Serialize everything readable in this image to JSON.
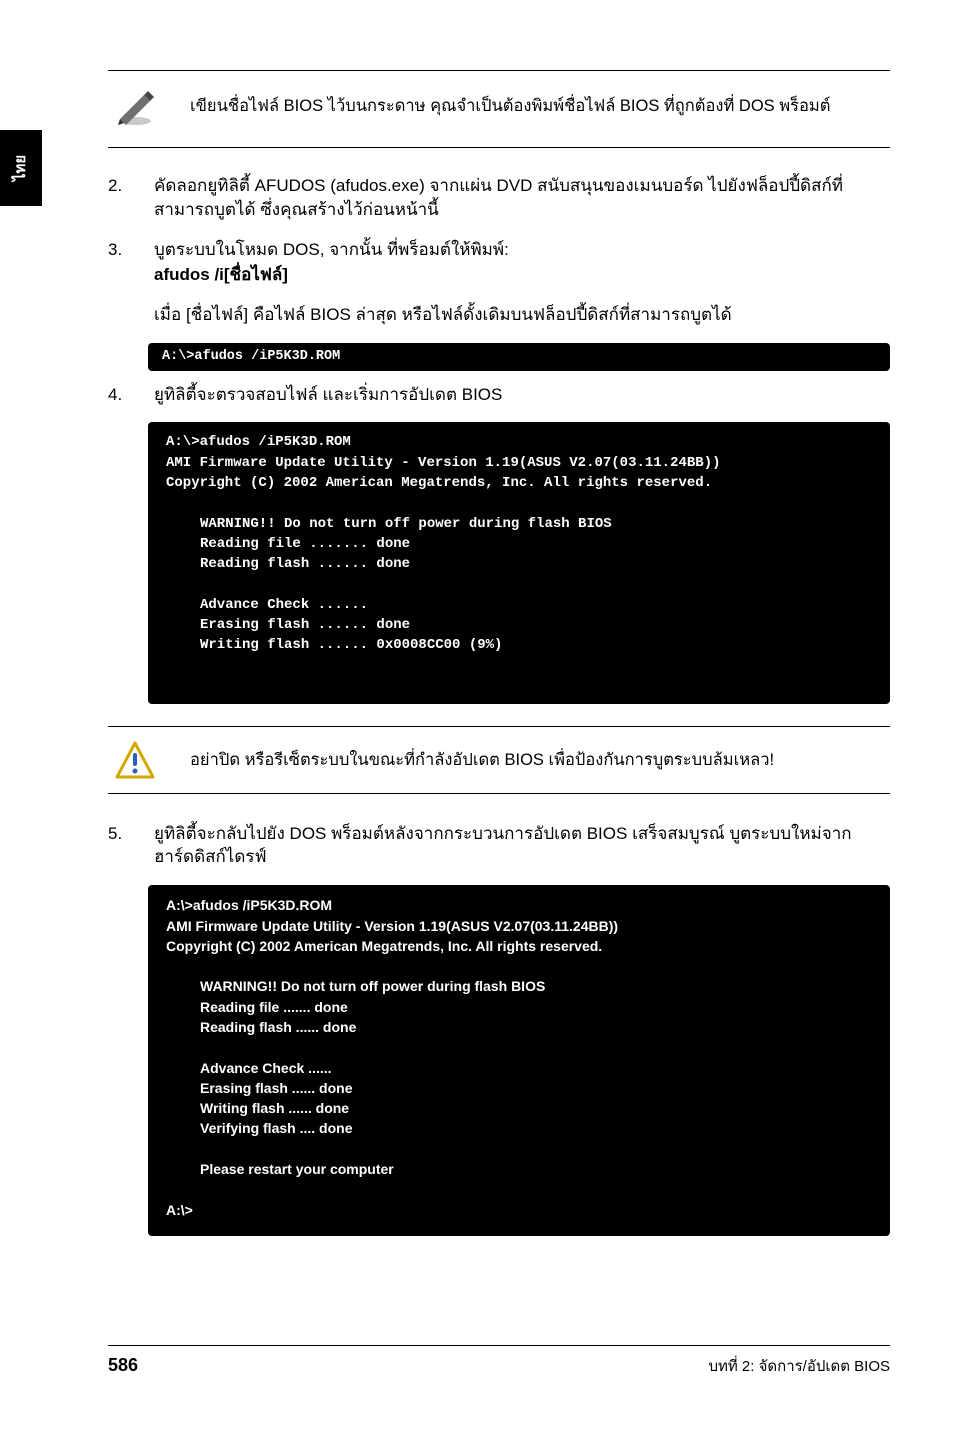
{
  "side_tab": "ไทย",
  "note1": {
    "icon": "pencil-icon",
    "text": "เขียนชื่อไฟล์ BIOS ไว้บนกระดาษ คุณจำเป็นต้องพิมพ์ชื่อไฟล์ BIOS ที่ถูกต้องที่ DOS พร็อมต์"
  },
  "steps": {
    "s2": {
      "num": "2.",
      "text": "คัดลอกยูทิลิตี้ AFUDOS (afudos.exe) จากแผ่น DVD สนับสนุนของเมนบอร์ด ไปยังฟล็อปปี้ดิสก์ที่สามารถบูตได้ ซึ่งคุณสร้างไว้ก่อนหน้านี้"
    },
    "s3": {
      "num": "3.",
      "line1": "บูตระบบในโหมด DOS, จากนั้น ที่พร็อมต์ให้พิมพ์:",
      "cmd": "afudos /i[ชื่อไฟล์]",
      "line2": "เมื่อ [ชื่อไฟล์] คือไฟล์ BIOS ล่าสุด หรือไฟล์ดั้งเดิมบนฟล็อปปี้ดิสก์ที่สามารถบูตได้"
    },
    "terminal_small": "A:\\>afudos /iP5K3D.ROM",
    "s4": {
      "num": "4.",
      "text": "ยูทิลิตี้จะตรวจสอบไฟล์ และเริ่มการอัปเดต BIOS"
    },
    "terminal_block1": {
      "l1": "A:\\>afudos /iP5K3D.ROM",
      "l2": "AMI Firmware Update Utility - Version 1.19(ASUS V2.07(03.11.24BB))",
      "l3": "Copyright (C) 2002 American Megatrends, Inc. All rights reserved.",
      "l5": "WARNING!! Do not turn off power during flash BIOS",
      "l6": "Reading file ....... done",
      "l7": "Reading flash ...... done",
      "l9": "Advance Check ......",
      "l10": "Erasing flash ...... done",
      "l11": "Writing flash ...... 0x0008CC00 (9%)"
    },
    "alert": {
      "icon": "alert-icon",
      "text": "อย่าปิด หรือรีเซ็ตระบบในขณะที่กำลังอัปเดต BIOS เพื่อป้องกันการบูตระบบล้มเหลว!"
    },
    "s5": {
      "num": "5.",
      "text": "ยูทิลิตี้จะกลับไปยัง DOS พร็อมต์หลังจากกระบวนการอัปเดต BIOS เสร็จสมบูรณ์ บูตระบบใหม่จากฮาร์ดดิสก์ไดรฟ์"
    },
    "terminal_block2": {
      "l1": "A:\\>afudos /iP5K3D.ROM",
      "l2": "AMI Firmware Update Utility - Version 1.19(ASUS V2.07(03.11.24BB))",
      "l3": "Copyright (C) 2002 American Megatrends, Inc. All rights reserved.",
      "l5": "WARNING!! Do not turn off power during flash BIOS",
      "l6": "Reading file ....... done",
      "l7": "Reading flash ...... done",
      "l9": "Advance Check ......",
      "l10": "Erasing flash ...... done",
      "l11": "Writing flash ...... done",
      "l12": "Verifying flash .... done",
      "l14": "Please restart your computer",
      "l16": "A:\\>"
    }
  },
  "footer": {
    "page": "586",
    "chapter": "บทที่ 2: จัดการ/อัปเดต BIOS"
  }
}
